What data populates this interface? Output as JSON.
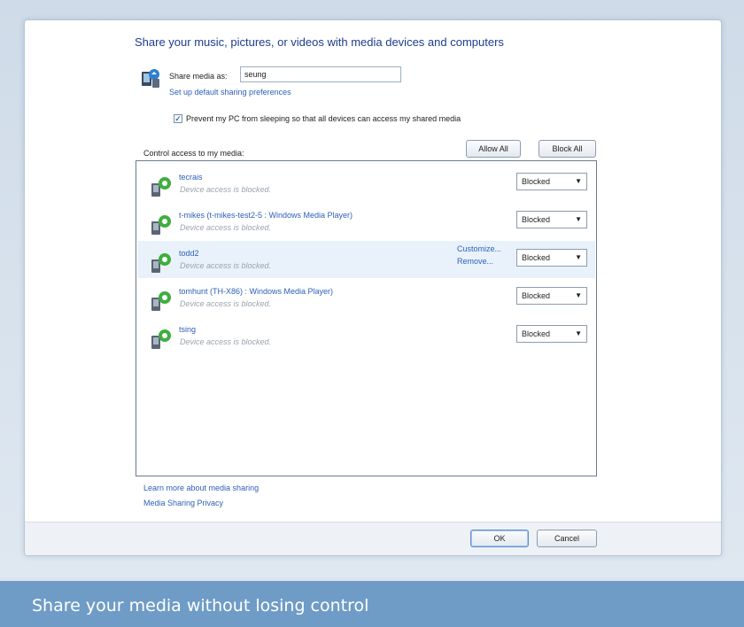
{
  "dialog": {
    "heading": "Share your music, pictures, or videos with media devices and computers",
    "share_media_label": "Share media as:",
    "share_media_value": "seung",
    "setup_link": "Set up default sharing preferences",
    "prevent_sleep_checked": true,
    "prevent_sleep_label": "Prevent my PC from sleeping so that all devices can access my shared media",
    "control_access_label": "Control access to my media:",
    "allow_all_label": "Allow All",
    "block_all_label": "Block All",
    "devices": [
      {
        "name": "tecrais",
        "status": "Device access is blocked.",
        "access": "Blocked",
        "selected": false
      },
      {
        "name": "t-mikes (t-mikes-test2-5 : Windows Media Player)",
        "status": "Device access is blocked.",
        "access": "Blocked",
        "selected": false
      },
      {
        "name": "todd2",
        "status": "Device access is blocked.",
        "access": "Blocked",
        "selected": true,
        "customize_label": "Customize...",
        "remove_label": "Remove..."
      },
      {
        "name": "tomhunt (TH-X86) : Windows Media Player)",
        "status": "Device access is blocked.",
        "access": "Blocked",
        "selected": false
      },
      {
        "name": "tsing",
        "status": "Device access is blocked.",
        "access": "Blocked",
        "selected": false
      }
    ],
    "learn_more_link": "Learn more about media sharing",
    "privacy_link": "Media Sharing Privacy",
    "ok_label": "OK",
    "cancel_label": "Cancel"
  },
  "caption": "Share your media without losing control",
  "colors": {
    "link": "#2d5fb8",
    "heading": "#1e3c8c",
    "caption_bar": "#6f9cc6",
    "device_icon_green": "#3fae3f"
  },
  "icons": {
    "share_icon": "media-share-icon",
    "device_icon": "media-device-icon"
  }
}
